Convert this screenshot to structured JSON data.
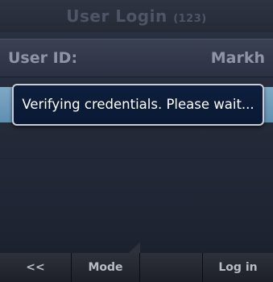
{
  "title_bar": {
    "title": "User Login",
    "extension": "(123)"
  },
  "field": {
    "label": "User ID:",
    "value": "Markh"
  },
  "dialog": {
    "message": "Verifying credentials. Please wait..."
  },
  "softkeys": {
    "key1": "<<",
    "key2": "Mode",
    "key3": "",
    "key4": "Log in"
  },
  "colors": {
    "highlight": "#6f9cbc",
    "dialog_bg": "#0d1f3d",
    "dialog_border": "#c7ccd6"
  }
}
